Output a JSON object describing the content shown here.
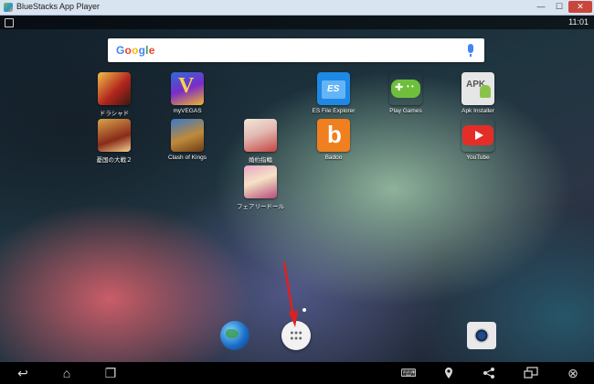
{
  "window": {
    "title": "BlueStacks App Player",
    "minimize_glyph": "—",
    "maximize_glyph": "☐",
    "close_glyph": "✕"
  },
  "status_bar": {
    "time": "11:01",
    "notification_icon": "notification-icon"
  },
  "search": {
    "logo_letters": [
      "G",
      "o",
      "o",
      "g",
      "l",
      "e"
    ],
    "mic_icon": "mic-icon"
  },
  "apps": {
    "dragon": "ドラシャド",
    "vegas": "myVEGAS",
    "es_file_explorer": "ES File Explorer",
    "play_games": "Play Games",
    "apk_installer": "Apk Installer",
    "kofu": "憂国の大戦２",
    "clash_of_kings": "Clash of Kings",
    "ring": "婚約指輪",
    "badoo": "Badoo",
    "youtube": "YouTube",
    "fairy": "フェアリードール"
  },
  "icon_glyphs": {
    "vegas": "V",
    "es": "ES",
    "apk": "APK",
    "badoo": "b"
  },
  "dock": {
    "browser_icon": "globe-icon",
    "apps_icon": "all-apps-icon",
    "camera_icon": "camera-icon"
  },
  "navbar": {
    "back_glyph": "↩",
    "home_glyph": "⌂",
    "recent_glyph": "❐",
    "keyboard_glyph": "⌨",
    "share_glyph": "⋖",
    "close_glyph": "⊗"
  },
  "colors": {
    "arrow": "#e02020",
    "title_bar": "#d9e4f1"
  }
}
